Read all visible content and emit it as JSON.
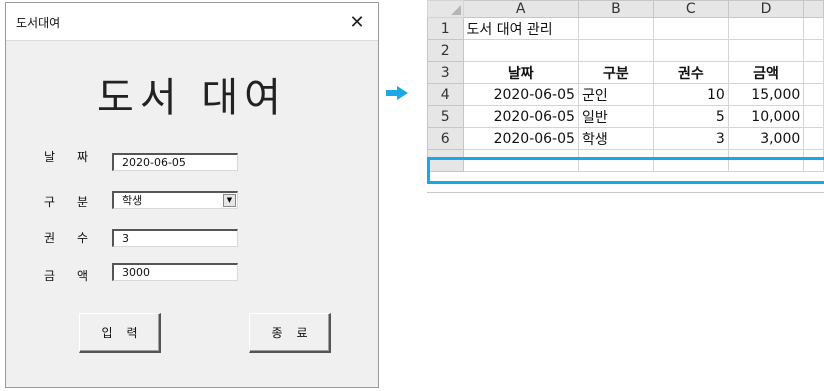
{
  "form": {
    "window_title": "도서대여",
    "close_glyph": "✕",
    "heading": "도서 대여",
    "fields": [
      {
        "label": "날짜",
        "value": "2020-06-05"
      },
      {
        "label": "구분",
        "value": "학생"
      },
      {
        "label": "권수",
        "value": "3"
      },
      {
        "label": "금액",
        "value": "3000"
      }
    ],
    "combo_arrow": "▼",
    "buttons": {
      "submit": "입력",
      "close": "종료"
    }
  },
  "arrow": {
    "icon": "right-arrow-icon",
    "color": "#1aa7e8"
  },
  "sheet": {
    "columns": [
      "A",
      "B",
      "C",
      "D"
    ],
    "rows": [
      {
        "num": "1",
        "cells": [
          "도서 대여 관리",
          "",
          "",
          ""
        ]
      },
      {
        "num": "2",
        "cells": [
          "",
          "",
          "",
          ""
        ]
      },
      {
        "num": "3",
        "cells": [
          "날짜",
          "구분",
          "권수",
          "금액"
        ]
      },
      {
        "num": "4",
        "cells": [
          "2020-06-05",
          "군인",
          "10",
          "15,000"
        ]
      },
      {
        "num": "5",
        "cells": [
          "2020-06-05",
          "일반",
          "5",
          "10,000"
        ]
      },
      {
        "num": "6",
        "cells": [
          "2020-06-05",
          "학생",
          "3",
          "3,000"
        ]
      }
    ],
    "highlight_color": "#1aa7e8"
  }
}
